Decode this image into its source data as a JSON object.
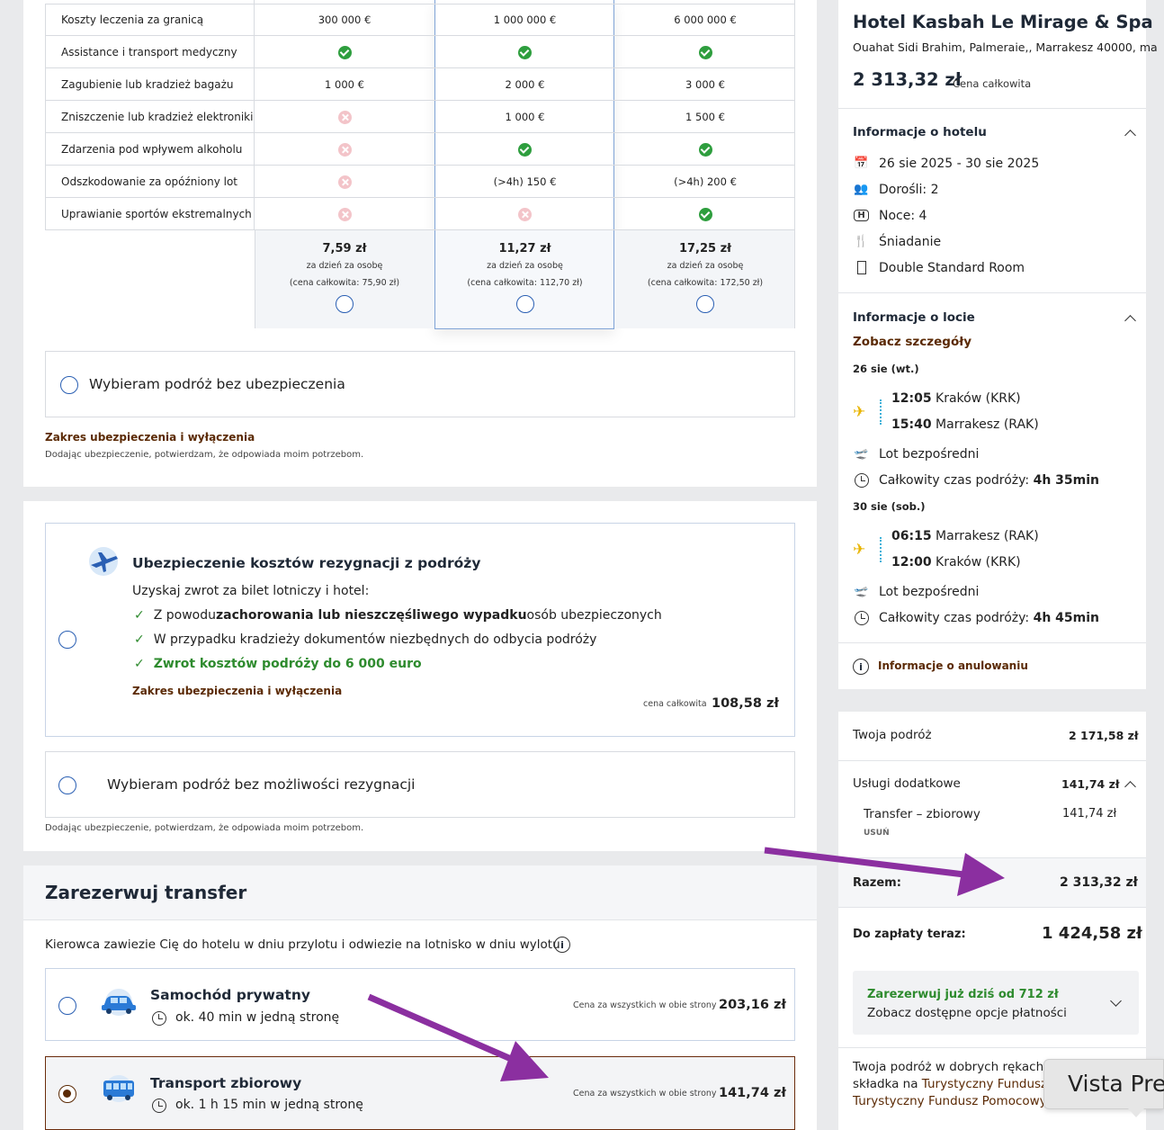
{
  "insurance_table": {
    "rows": [
      {
        "label": "Koszty leczenia za granicą",
        "values": [
          "300 000 €",
          "1 000 000 €",
          "6 000 000 €"
        ]
      },
      {
        "label": "Assistance i transport medyczny",
        "values": [
          "check",
          "check",
          "check"
        ]
      },
      {
        "label": "Zagubienie lub kradzież bagażu",
        "values": [
          "1 000 €",
          "2 000 €",
          "3 000 €"
        ]
      },
      {
        "label": "Zniszczenie lub kradzież elektroniki",
        "values": [
          "cross",
          "1 000 €",
          "1 500 €"
        ]
      },
      {
        "label": "Zdarzenia pod wpływem alkoholu",
        "values": [
          "cross",
          "check",
          "check"
        ]
      },
      {
        "label": "Odszkodowanie za opóźniony lot",
        "values": [
          "cross",
          "(>4h) 150 €",
          "(>4h) 200 €"
        ]
      },
      {
        "label": "Uprawianie sportów ekstremalnych",
        "values": [
          "cross",
          "cross",
          "check"
        ]
      }
    ],
    "prices": [
      {
        "price": "7,59 zł",
        "per": "za dzień za osobę",
        "total": "(cena całkowita: 75,90 zł)"
      },
      {
        "price": "11,27 zł",
        "per": "za dzień za osobę",
        "total": "(cena całkowita: 112,70 zł)"
      },
      {
        "price": "17,25 zł",
        "per": "za dzień za osobę",
        "total": "(cena całkowita: 172,50 zł)"
      }
    ],
    "no_insurance": "Wybieram podróż bez ubezpieczenia",
    "scope_link": "Zakres ubezpieczenia i wyłączenia",
    "disclaimer": "Dodając ubezpieczenie, potwierdzam, że odpowiada moim potrzebom."
  },
  "cancellation": {
    "title": "Ubezpieczenie kosztów rezygnacji z podróży",
    "intro": "Uzyskaj zwrot za bilet lotniczy i hotel:",
    "b1_pre": "Z powodu ",
    "b1_bold": "zachorowania lub nieszczęśliwego wypadku",
    "b1_post": " osób ubezpieczonych",
    "b2": "W przypadku kradzieży dokumentów niezbędnych do odbycia podróży",
    "b3": "Zwrot kosztów podróży do 6 000 euro",
    "scope_link": "Zakres ubezpieczenia i wyłączenia",
    "price_label": "cena całkowita",
    "price": "108,58 zł",
    "no_option": "Wybieram podróż bez możliwości rezygnacji",
    "disclaimer": "Dodając ubezpieczenie, potwierdzam, że odpowiada moim potrzebom."
  },
  "transfer": {
    "title": "Zarezerwuj transfer",
    "intro": "Kierowca zawiezie Cię do hotelu w dniu przylotu i odwiezie na lotnisko w dniu wylotu.",
    "options": [
      {
        "name": "Samochód prywatny",
        "time": "ok. 40 min w jedną stronę",
        "price_label": "Cena za wszystkich w obie strony",
        "price": "203,16 zł"
      },
      {
        "name": "Transport zbiorowy",
        "time": "ok. 1 h 15 min w jedną stronę",
        "price_label": "Cena za wszystkich w obie strony",
        "price": "141,74 zł"
      }
    ]
  },
  "hotel": {
    "name": "Hotel Kasbah Le Mirage & Spa",
    "address": "Ouahat Sidi Brahim, Palmeraie,, Marrakesz 40000, ma",
    "price": "2 313,32 zł",
    "price_label": "Cena całkowita",
    "info_title": "Informacje o hotelu",
    "dates": "26 sie 2025 - 30 sie 2025",
    "adults": "Dorośli: 2",
    "nights": "Noce: 4",
    "board": "Śniadanie",
    "room": "Double Standard Room"
  },
  "flights": {
    "title": "Informacje o locie",
    "details_link": "Zobacz szczegóły",
    "out": {
      "date": "26 sie (wt.)",
      "dep_time": "12:05",
      "dep": "Kraków (KRK)",
      "arr_time": "15:40",
      "arr": "Marrakesz (RAK)",
      "type": "Lot bezpośredni",
      "dur_label": "Całkowity czas podróży: ",
      "dur": "4h 35min"
    },
    "ret": {
      "date": "30 sie (sob.)",
      "dep_time": "06:15",
      "dep": "Marrakesz (RAK)",
      "arr_time": "12:00",
      "arr": "Kraków (KRK)",
      "type": "Lot bezpośredni",
      "dur_label": "Całkowity czas podróży: ",
      "dur": "4h 45min"
    },
    "cancel_info": "Informacje o anulowaniu"
  },
  "summary": {
    "trip_label": "Twoja podróż",
    "trip": "2 171,58 zł",
    "extras_label": "Usługi dodatkowe",
    "extras": "141,74 zł",
    "transfer_label": "Transfer – zbiorowy",
    "transfer": "141,74 zł",
    "remove": "USUŃ",
    "total_label": "Razem:",
    "total": "2 313,32 zł",
    "pay_now_label": "Do zapłaty teraz:",
    "pay_now": "1 424,58 zł",
    "book_today": "Zarezerwuj już dziś od 712 zł",
    "payment_options": "Zobacz dostępne opcje płatności",
    "trust_line1": "Twoja podróż w dobrych rękach!",
    "trust_pre": "składka na ",
    "trust_link": "Turystyczny Fundusz",
    "trust_line3": "Turystyczny Fundusz Pomocowy"
  },
  "tooltip": "Vista Pre",
  "colors": {
    "accent": "#2a5fb3",
    "brown": "#5b2a05",
    "green": "#2e8b2e",
    "arrow": "#8b2fa0"
  }
}
